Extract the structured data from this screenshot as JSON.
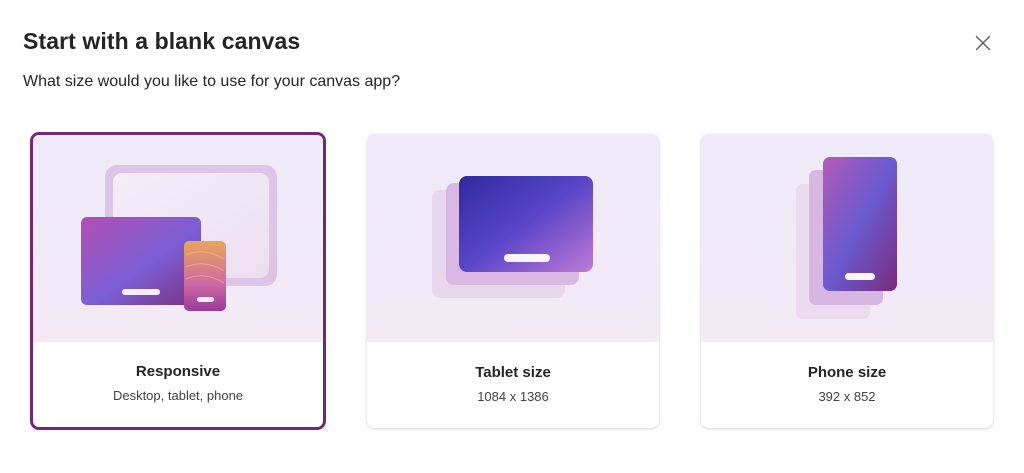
{
  "dialog": {
    "title": "Start with a blank canvas",
    "subtitle": "What size would you like to use for your canvas app?",
    "close_icon": "close-icon"
  },
  "options": [
    {
      "name": "Responsive",
      "description": "Desktop, tablet, phone",
      "selected": true
    },
    {
      "name": "Tablet size",
      "description": "1084 x 1386",
      "selected": false
    },
    {
      "name": "Phone size",
      "description": "392 x 852",
      "selected": false
    }
  ],
  "colors": {
    "selected_border": "#742774",
    "card_art_bg": "#efebfa",
    "title_text": "#242424"
  }
}
